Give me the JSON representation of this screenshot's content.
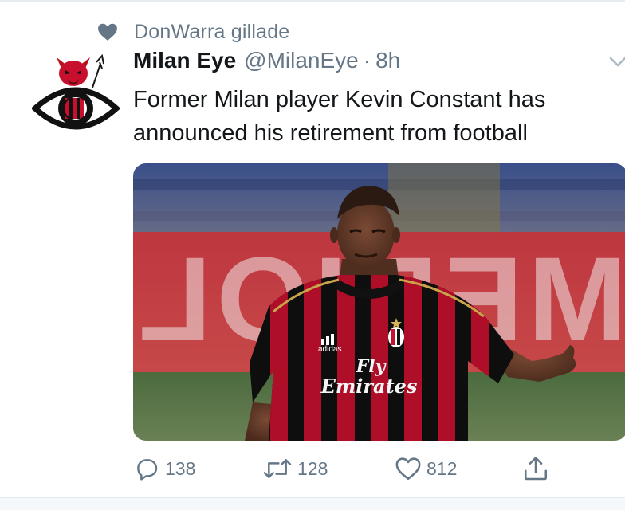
{
  "social_context": {
    "icon": "heart-icon",
    "text": "DonWarra gillade"
  },
  "author": {
    "name": "Milan Eye",
    "handle": "@MilanEye",
    "separator": "·",
    "timestamp": "8h",
    "avatar_icon": "devil-eye-logo"
  },
  "tweet": {
    "text_line1": "Former Milan player Kevin Constant has",
    "text_line2": "announced his retirement from football"
  },
  "media": {
    "jersey_brand": "adidas",
    "jersey_sponsor_line1": "Fly",
    "jersey_sponsor_line2": "Emirates",
    "background_text": "MEDIOLANUM"
  },
  "actions": {
    "reply": {
      "icon": "reply-icon",
      "count": "138"
    },
    "retweet": {
      "icon": "retweet-icon",
      "count": "128"
    },
    "like": {
      "icon": "like-icon",
      "count": "812"
    },
    "share": {
      "icon": "share-icon"
    }
  },
  "colors": {
    "primary_text": "#14171a",
    "secondary_text": "#657786",
    "milan_red": "#c8102e",
    "jersey_black": "#111111"
  }
}
